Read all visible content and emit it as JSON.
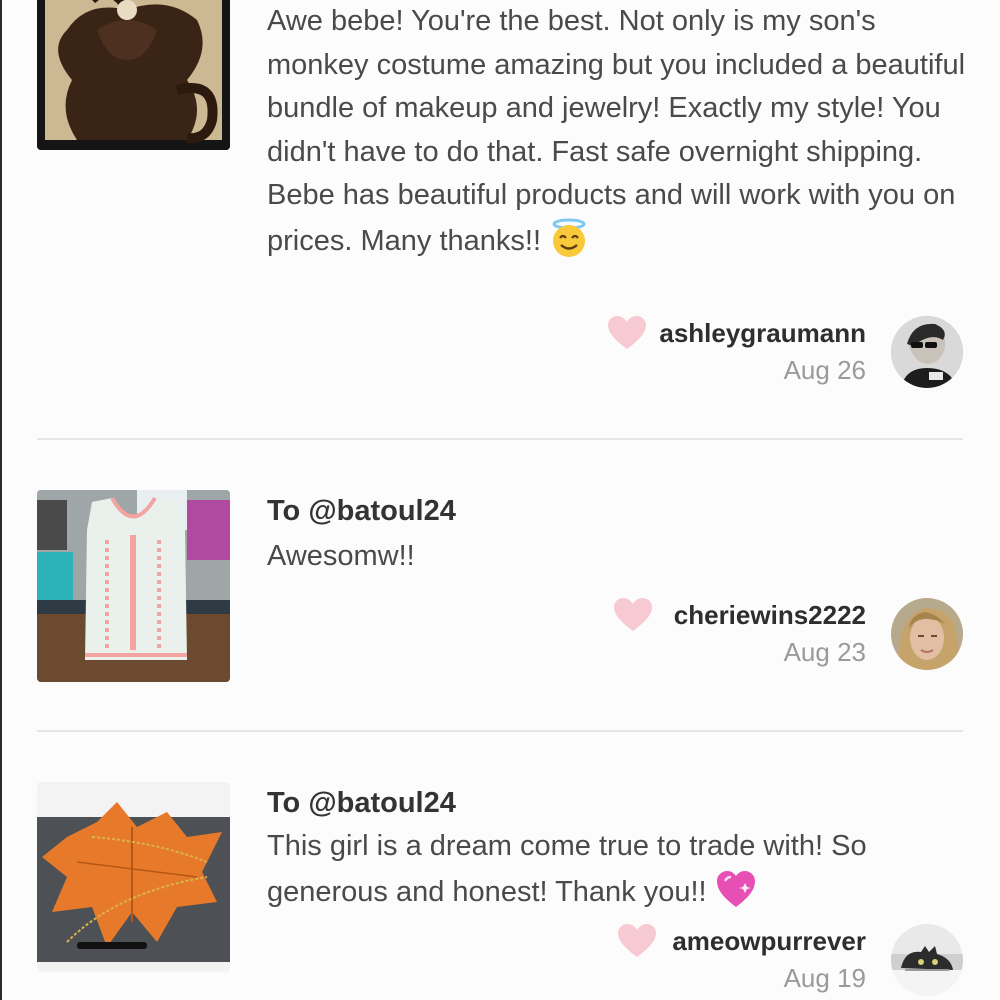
{
  "reviews": [
    {
      "to_prefix": "",
      "to_handle": "",
      "body": "Awe bebe! You're the best. Not only is my son's monkey costume amazing but you included a beautiful bundle of makeup and jewelry! Exactly my style! You didn't have to do that. Fast safe overnight shipping. Bebe has beautiful products and will work with you on prices. Many thanks!!",
      "emoji": "smiling-face-with-halo",
      "username": "ashleygraumann",
      "date": "Aug 26",
      "thumbnail": "monkey-costume-photo"
    },
    {
      "to_prefix": "To",
      "to_handle": "@batoul24",
      "body": "Awesomw!!",
      "username": "cheriewins2222",
      "date": "Aug 23",
      "thumbnail": "embroidered-top-photo"
    },
    {
      "to_prefix": "To",
      "to_handle": "@batoul24",
      "body": "This girl is a dream come true to trade with! So generous and honest! Thank you!!",
      "emoji": "sparkling-heart",
      "username": "ameowpurrever",
      "date": "Aug 19",
      "thumbnail": "leaf-bracelet-photo"
    }
  ],
  "colors": {
    "heart": "#f7c9d3",
    "divider": "#e6e6e6",
    "username": "#2e2e2e",
    "date": "#9a9a9a"
  }
}
